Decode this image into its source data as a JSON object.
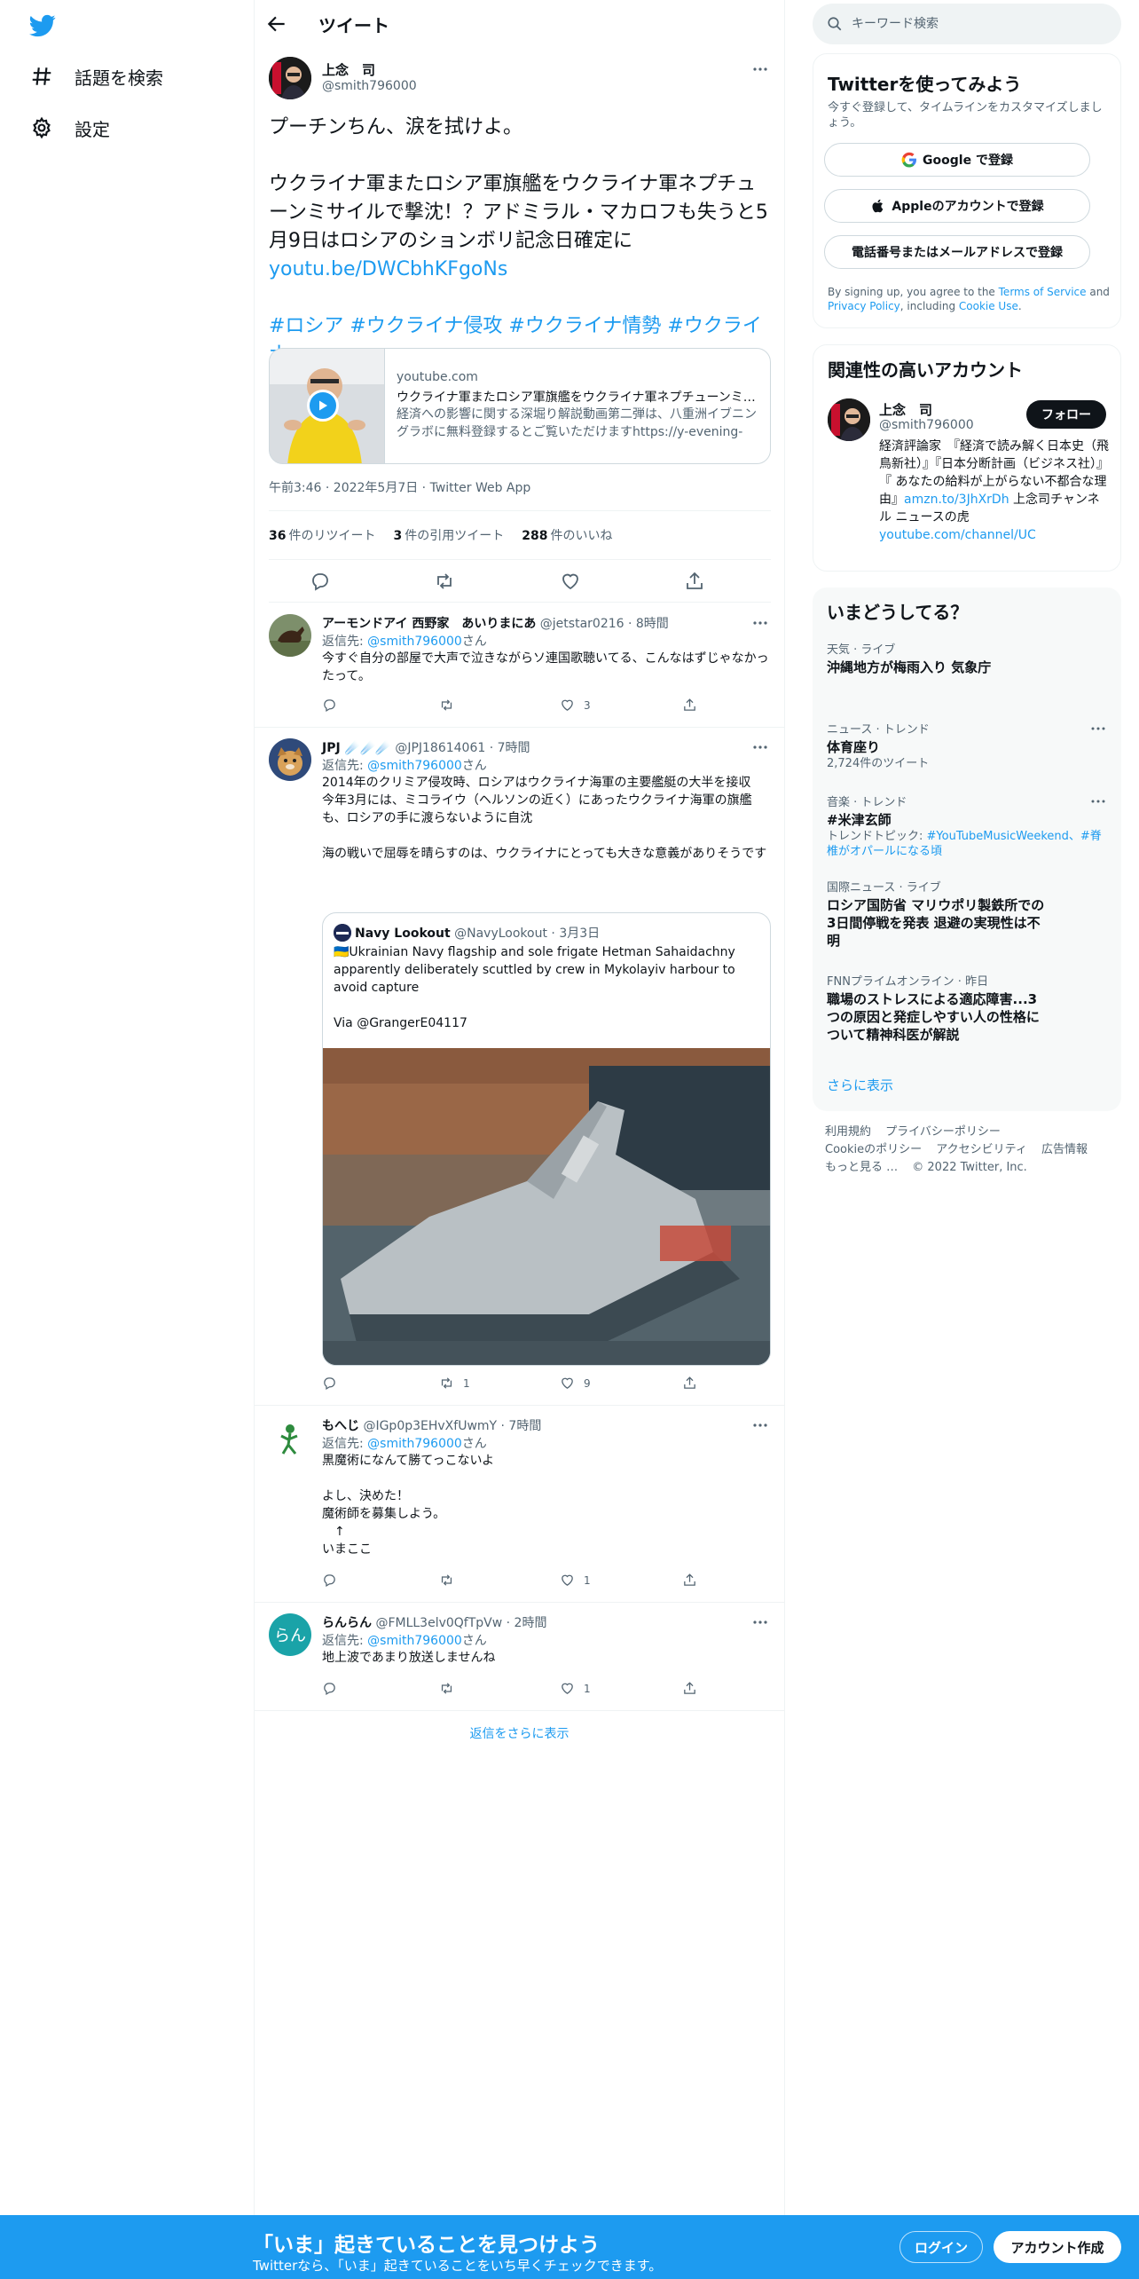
{
  "nav": {
    "explore_label": "話題を検索",
    "settings_label": "設定"
  },
  "header": {
    "title": "ツイート"
  },
  "tweet": {
    "author_name": "上念　司",
    "author_handle": "@smith796000",
    "line1": "プーチンちん、涙を拭けよ。",
    "line2": "ウクライナ軍またロシア軍旗艦をウクライナ軍ネプチューンミサイルで撃沈！？アドミラル・マカロフも失うと5月9日はロシアのションボリ記念日確定に",
    "link": "youtu.be/DWCbhKFgoNs",
    "hashtags": "#ロシア #ウクライナ侵攻 #ウクライナ情勢 #ウクライナ",
    "card": {
      "domain": "youtube.com",
      "title": "ウクライナ軍またロシア軍旗艦をウクライナ軍ネプチューンミサイルで撃沈",
      "description": "経済への影響に関する深堀り解説動画第二弾は、八重洲イブニングラボに無料登録するとご覧いただけますhttps://y-evening-lab.com"
    },
    "meta": "午前3:46 · 2022年5月7日 · Twitter Web App",
    "stats": {
      "retweets": "36",
      "retweets_label": "件のリツイート",
      "quotes": "3",
      "quotes_label": "件の引用ツイート",
      "likes": "288",
      "likes_label": "件のいいね"
    }
  },
  "replies": [
    {
      "name": "アーモンドアイ 西野家　あいりまにあ",
      "handle": "@jetstar0216 · 8時間",
      "replyto_prefix": "返信先: ",
      "replyto": "@smith796000",
      "replyto_suffix": "さん",
      "text": "今すぐ自分の部屋で大声で泣きながらソ連国歌聴いてる、こんなはずじゃなかったって。",
      "retweets": "",
      "likes": "3"
    },
    {
      "name": "JPJ ☄️☄️☄️",
      "handle": "@JPJ18614061 · 7時間",
      "replyto_prefix": "返信先: ",
      "replyto": "@smith796000",
      "replyto_suffix": "さん",
      "text": "2014年のクリミア侵攻時、ロシアはウクライナ海軍の主要艦艇の大半を接収\n今年3月には、ミコライウ（ヘルソンの近く）にあったウクライナ海軍の旗艦も、ロシアの手に渡らないように自沈\n\n海の戦いで屈辱を晴らすのは、ウクライナにとっても大きな意義がありそうです",
      "quote": {
        "name": "Navy Lookout",
        "handle": "@NavyLookout · 3月3日",
        "text": "🇺🇦Ukrainian Navy flagship and sole frigate Hetman Sahaidachny apparently deliberately scuttled by crew in Mykolayiv harbour to avoid capture\n\nVia @GrangerE04117"
      },
      "retweets": "1",
      "likes": "9"
    },
    {
      "name": "もへじ",
      "handle": "@IGp0p3EHvXfUwmY · 7時間",
      "replyto_prefix": "返信先: ",
      "replyto": "@smith796000",
      "replyto_suffix": "さん",
      "text": "黒魔術になんて勝てっこないよ\n\nよし、決めた！\n魔術師を募集しよう。\n　↑\nいまここ",
      "retweets": "",
      "likes": "1"
    },
    {
      "name": "らんらん",
      "handle": "@FMLL3elv0QfTpVw · 2時間",
      "avatar_text": "らん",
      "replyto_prefix": "返信先: ",
      "replyto": "@smith796000",
      "replyto_suffix": "さん",
      "text": "地上波であまり放送しませんね",
      "retweets": "",
      "likes": "1"
    }
  ],
  "show_more_replies": "返信をさらに表示",
  "search": {
    "placeholder": "キーワード検索"
  },
  "signup": {
    "title": "Twitterを使ってみよう",
    "subtitle": "今すぐ登録して、タイムラインをカスタマイズしましょう。",
    "google": "Google で登録",
    "apple": "Appleのアカウントで登録",
    "phone": "電話番号またはメールアドレスで登録",
    "terms_prefix": "By signing up, you agree to the ",
    "terms_link": "Terms of Service",
    "terms_and": " and ",
    "privacy_link": "Privacy Policy",
    "terms_including": ", including ",
    "cookie_link": "Cookie Use",
    "terms_end": "."
  },
  "related": {
    "title": "関連性の高いアカウント",
    "name": "上念　司",
    "handle": "@smith796000",
    "follow": "フォロー",
    "bio": "経済評論家　『経済で読み解く日本史（飛鳥新社）』『日本分断計画（ビジネス社）』『 あなたの給料が上がらない不都合な理由』",
    "bio_link1": "amzn.to/3JhXrDh",
    "bio_mid": " 上念司チャンネル ニュースの虎 ",
    "bio_link2": "youtube.com/channel/UC"
  },
  "trends": {
    "title": "いまどうしてる？",
    "items": [
      {
        "meta": "天気 · ライブ",
        "title": "沖縄地方が梅雨入り 気象庁",
        "sub": ""
      },
      {
        "meta": "ニュース · トレンド",
        "title": "体育座り",
        "sub": "2,724件のツイート"
      },
      {
        "meta": "音楽 · トレンド",
        "title": "#米津玄師",
        "sub_prefix": "トレンドトピック: ",
        "sub_link": "#YouTubeMusicWeekend、#脊椎がオパールになる頃"
      },
      {
        "meta": "国際ニュース · ライブ",
        "title": "ロシア国防省 マリウポリ製鉄所での3日間停戦を発表 退避の実現性は不明",
        "sub": ""
      },
      {
        "meta": "FNNプライムオンライン · 昨日",
        "title": "職場のストレスによる適応障害...3つの原因と発症しやすい人の性格について精神科医が解説",
        "sub": ""
      }
    ],
    "show_more": "さらに表示"
  },
  "footer": {
    "links": [
      "利用規約",
      "プライバシーポリシー",
      "Cookieのポリシー",
      "アクセシビリティ",
      "広告情報",
      "もっと見る …",
      "© 2022 Twitter, Inc."
    ]
  },
  "bottombar": {
    "title": "「いま」起きていることを見つけよう",
    "subtitle": "Twitterなら、「いま」起きていることをいち早くチェックできます。",
    "login": "ログイン",
    "signup": "アカウント作成"
  },
  "colors": {
    "accent": "#1d9bf0",
    "text": "#0f1419",
    "muted": "#536471",
    "border": "#eff3f4"
  }
}
